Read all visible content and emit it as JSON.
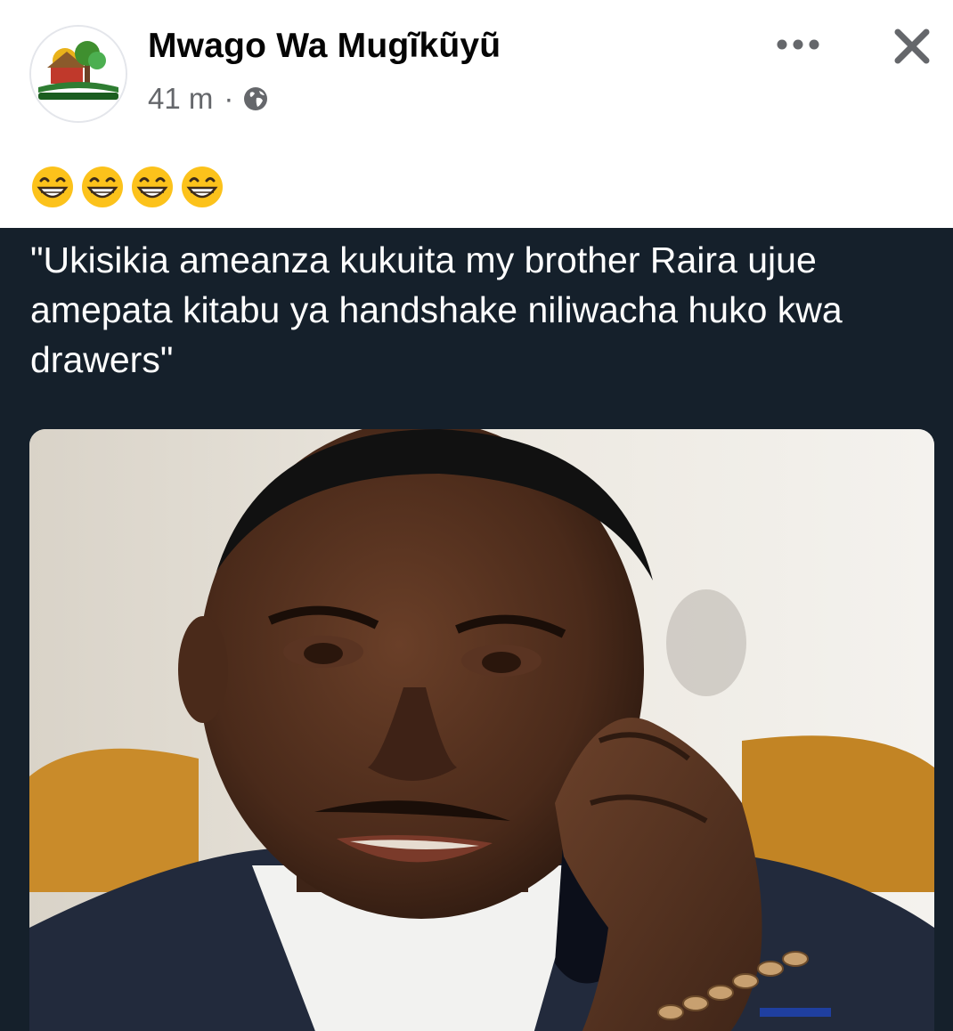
{
  "post": {
    "author": "Mwago Wa Mugĩkũyũ",
    "time": "41 m",
    "separator": "·",
    "audience_icon": "globe-icon",
    "caption_emojis": [
      "grinning-face-icon",
      "grinning-face-icon",
      "grinning-face-icon",
      "grinning-face-icon"
    ],
    "meme_quote": "\"Ukisikia ameanza kukuita my brother Raira ujue amepata kitabu ya handshake niliwacha huko kwa drawers\"",
    "actions": {
      "more_icon": "more-horizontal-icon",
      "close_icon": "close-icon"
    }
  },
  "colors": {
    "meme_background": "#15202b",
    "name_text": "#050505",
    "meta_text": "#65676b"
  }
}
